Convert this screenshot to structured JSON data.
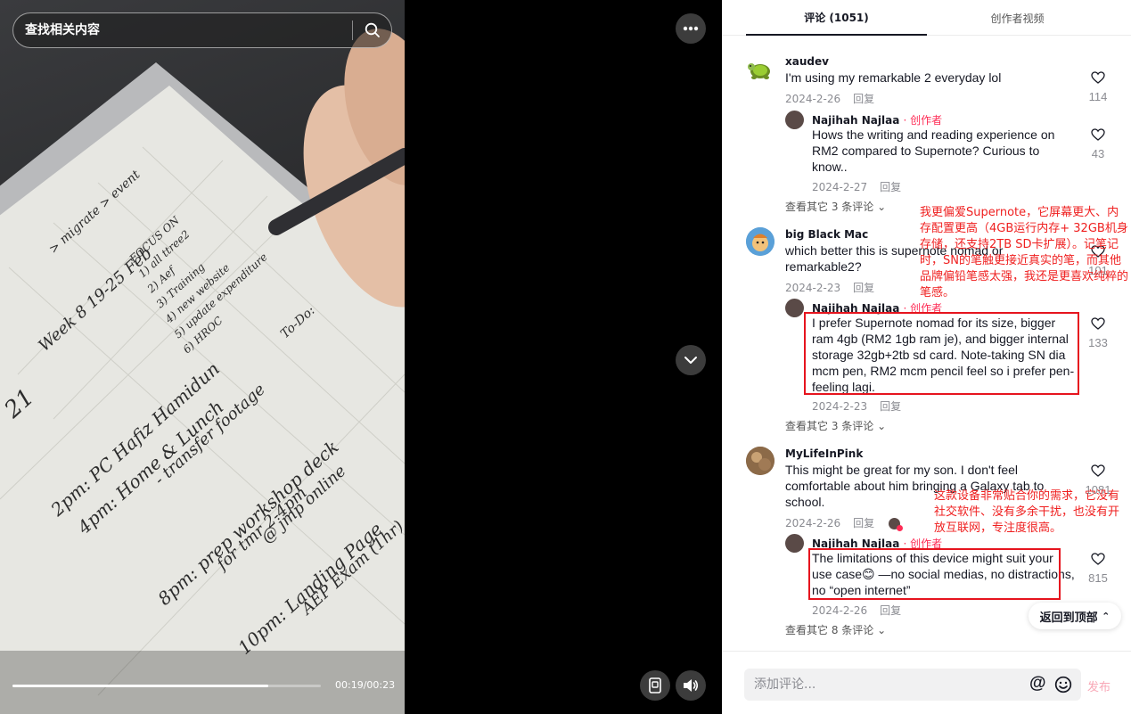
{
  "search": {
    "placeholder": "查找相关内容"
  },
  "video": {
    "progress_fraction": 0.83,
    "time": "00:19/00:23",
    "handwriting": {
      "header": "Week 8 19-25 Feb",
      "agenda": "> migrate > event",
      "focus": [
        "FOCUS ON",
        "1) all ttree2",
        "2) Aef",
        "3) Training",
        "4) new website",
        "5) update expenditure",
        "6) HROC"
      ],
      "todo": "To-Do:",
      "day": "21",
      "lines": [
        "2pm: PC Hafiz Hamidun",
        "4pm: Home & Lunch",
        "- transfer footage",
        "8pm: prep workshop deck",
        "for tmr 2-4pm",
        "@ jmp online",
        "10pm: Landing Page",
        "AEP Exam (1hr)"
      ]
    }
  },
  "tabs": {
    "comments": "评论 (1051)",
    "creator_videos": "创作者视频"
  },
  "comments": [
    {
      "author": "xaudev",
      "text": "I'm using my remarkable 2 everyday lol",
      "date": "2024-2-26",
      "reply": "回复",
      "likes": "114",
      "replies": [
        {
          "author": "Najihah Najlaa",
          "tag": "· 创作者",
          "text": "Hows the writing and reading experience on RM2 compared to Supernote? Curious to know..",
          "date": "2024-2-27",
          "reply": "回复",
          "likes": "43"
        }
      ],
      "more": "查看其它 3 条评论"
    },
    {
      "author": "big Black Mac",
      "text": "which better this is supernote nomad or remarkable2?",
      "date": "2024-2-23",
      "reply": "回复",
      "likes": "101",
      "replies": [
        {
          "author": "Najihah Najlaa",
          "tag": "· 创作者",
          "text": "I prefer Supernote nomad for its size, bigger ram 4gb (RM2 1gb ram je), and bigger internal storage 32gb+2tb sd card. Note-taking SN dia mcm pen, RM2 mcm pencil feel so i prefer pen-feeling lagi.",
          "date": "2024-2-23",
          "reply": "回复",
          "likes": "133"
        }
      ],
      "more": "查看其它 3 条评论"
    },
    {
      "author": "MyLifeInPink",
      "text": "This might be great for my son. I don't feel comfortable about him bringing a Galaxy tab to school.",
      "date": "2024-2-26",
      "reply": "回复",
      "likes": "1081",
      "replies": [
        {
          "author": "Najihah Najlaa",
          "tag": "· 创作者",
          "text": "The limitations of this device might suit your use case😊 —no social medias, no distractions, no “open internet”",
          "date": "2024-2-26",
          "reply": "回复",
          "likes": "815"
        }
      ],
      "more": "查看其它 8 条评论"
    }
  ],
  "annotations": {
    "first": "我更偏爱Supernote，它屏幕更大、内存配置更高（4GB运行内存+ 32GB机身存储，还支持2TB SD卡扩展）。记笔记时，SN的笔触更接近真实的笔，而其他品牌偏铅笔感太强，我还是更喜欢纯粹的笔感。",
    "second": "这款设备非常贴合你的需求，它没有社交软件、没有多余干扰，也没有开放互联网，专注度很高。"
  },
  "back_to_top": "返回到顶部",
  "comment_input": {
    "placeholder": "添加评论...",
    "at_symbol": "@",
    "publish": "发布"
  },
  "colors": {
    "accent": "#fe2c55",
    "annotation": "#e6141e",
    "dark_button": "#3c3c3c"
  }
}
